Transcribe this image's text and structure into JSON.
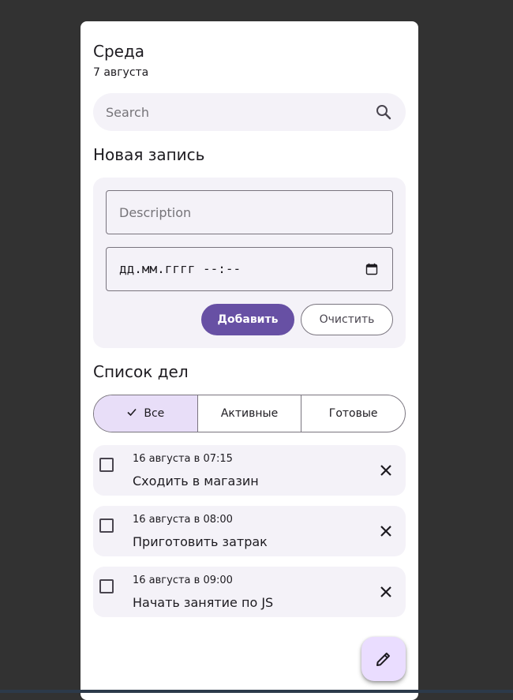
{
  "header": {
    "day": "Среда",
    "date": "7 августа"
  },
  "search": {
    "placeholder": "Search",
    "value": ""
  },
  "new_entry": {
    "title": "Новая запись",
    "description_placeholder": "Description",
    "datetime_placeholder": "дд.мм.гггг --:--",
    "add_label": "Добавить",
    "clear_label": "Очистить"
  },
  "todo": {
    "title": "Список дел",
    "filters": [
      {
        "label": "Все",
        "selected": true
      },
      {
        "label": "Активные",
        "selected": false
      },
      {
        "label": "Готовые",
        "selected": false
      }
    ],
    "items": [
      {
        "when": "16 августа в 07:15",
        "text": "Сходить в магазин",
        "done": false
      },
      {
        "when": "16 августа в 08:00",
        "text": "Приготовить затрак",
        "done": false
      },
      {
        "when": "16 августа в 09:00",
        "text": "Начать занятие по JS",
        "done": false
      }
    ]
  },
  "icons": {
    "search": "search-icon",
    "calendar": "calendar-icon",
    "check": "check-icon",
    "close": "close-icon",
    "edit": "pencil-icon"
  },
  "colors": {
    "primary": "#6750a4",
    "surface_container": "#f4f2f8",
    "secondary_container": "#e8def8",
    "fab": "#eaddff",
    "backdrop": "#323232"
  }
}
